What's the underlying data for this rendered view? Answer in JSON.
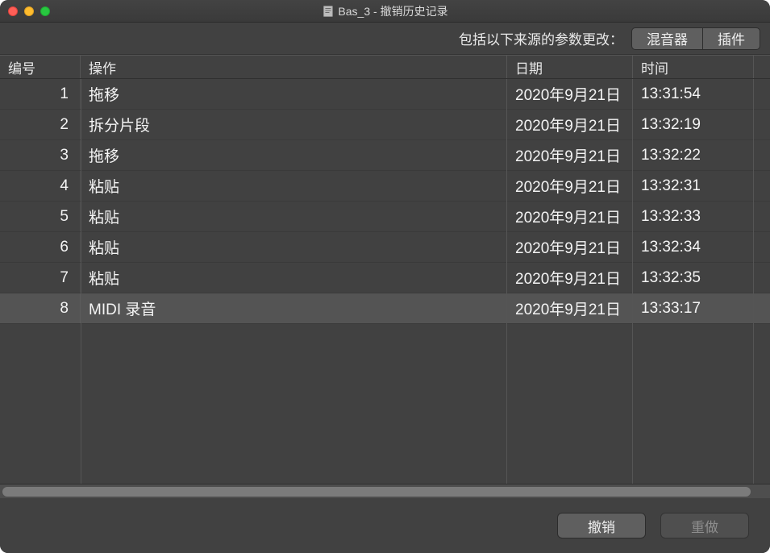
{
  "window": {
    "title": "Bas_3 - 撤销历史记录"
  },
  "filter": {
    "label": "包括以下来源的参数更改：",
    "mixer": "混音器",
    "plugins": "插件"
  },
  "columns": {
    "num": "编号",
    "op": "操作",
    "date": "日期",
    "time": "时间"
  },
  "rows": [
    {
      "num": "1",
      "op": "拖移",
      "date": "2020年9月21日",
      "time": "13:31:54"
    },
    {
      "num": "2",
      "op": "拆分片段",
      "date": "2020年9月21日",
      "time": "13:32:19"
    },
    {
      "num": "3",
      "op": "拖移",
      "date": "2020年9月21日",
      "time": "13:32:22"
    },
    {
      "num": "4",
      "op": "粘贴",
      "date": "2020年9月21日",
      "time": "13:32:31"
    },
    {
      "num": "5",
      "op": "粘贴",
      "date": "2020年9月21日",
      "time": "13:32:33"
    },
    {
      "num": "6",
      "op": "粘贴",
      "date": "2020年9月21日",
      "time": "13:32:34"
    },
    {
      "num": "7",
      "op": "粘贴",
      "date": "2020年9月21日",
      "time": "13:32:35"
    },
    {
      "num": "8",
      "op": "MIDI 录音",
      "date": "2020年9月21日",
      "time": "13:33:17"
    }
  ],
  "selectedRow": 8,
  "footer": {
    "undo": "撤销",
    "redo": "重做"
  }
}
